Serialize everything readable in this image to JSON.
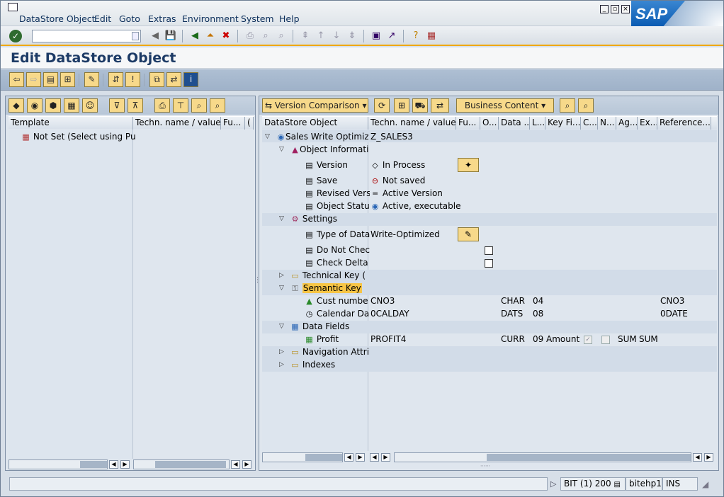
{
  "menubar": {
    "items": [
      "DataStore Object",
      "Edit",
      "Goto",
      "Extras",
      "Environment",
      "System",
      "Help"
    ],
    "brand": "SAP"
  },
  "system_toolbar": {
    "command_value": ""
  },
  "screen_title": "Edit DataStore Object",
  "left_pane": {
    "columns": [
      "Template",
      "Techn. name / value",
      "Fu...",
      "("
    ],
    "rows": [
      {
        "icon": "table-icon",
        "text": "Not Set (Select using Pu"
      }
    ]
  },
  "right_pane": {
    "toolbar": {
      "version_comparison": "Version Comparison",
      "business_content": "Business Content"
    },
    "columns": [
      "DataStore Object",
      "Techn. name / value",
      "Fu...",
      "O...",
      "Data ...",
      "L...",
      "Key Fi...",
      "C...",
      "N...",
      "Ag...",
      "Ex...",
      "Reference..."
    ],
    "tree": {
      "root_text": "Sales Write Optimiz",
      "root_tech": "Z_SALES3",
      "object_info": "Object Informatio",
      "version_label": "Version",
      "version_value": "In Process",
      "save_label": "Save",
      "save_value": "Not saved",
      "revised_label": "Revised Vers",
      "revised_value": "Active Version",
      "status_label": "Object Status",
      "status_value": "Active, executable",
      "settings": "Settings",
      "type_label": "Type of Data",
      "type_value": "Write-Optimized",
      "do_not_check": "Do Not Chec",
      "check_delta": "Check Delta",
      "technical_key": "Technical Key (",
      "semantic_key": "Semantic Key",
      "cust_label": "Cust numbe",
      "cust_tech": "CNO3",
      "cust_type": "CHAR",
      "cust_len": "04",
      "cust_ref": "CNO3",
      "cal_label": "Calendar Da",
      "cal_tech": "0CALDAY",
      "cal_type": "DATS",
      "cal_len": "08",
      "cal_ref": "0DATE",
      "data_fields": "Data Fields",
      "profit_label": "Profit",
      "profit_tech": "PROFIT4",
      "profit_type": "CURR",
      "profit_len": "09",
      "profit_keyfig": "Amount",
      "profit_agg": "SUM",
      "profit_ex": "SUM",
      "navigation": "Navigation Attrib",
      "indexes": "Indexes"
    }
  },
  "statusbar": {
    "system": "BIT (1) 200",
    "server": "bitehp1",
    "mode": "INS"
  }
}
